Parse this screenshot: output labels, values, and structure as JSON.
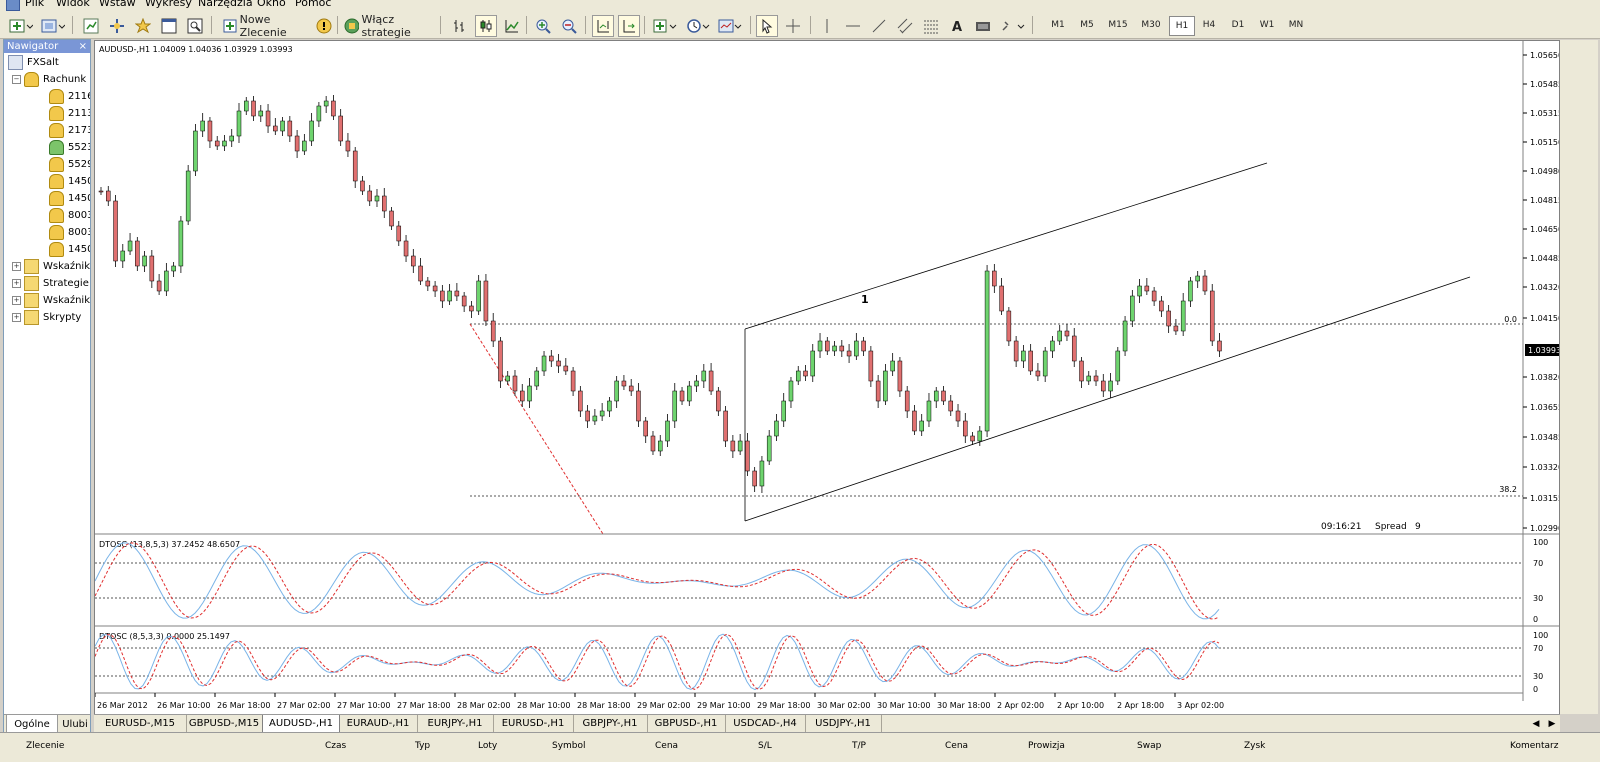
{
  "menu": {
    "items": [
      "Plik",
      "Widok",
      "Wstaw",
      "Wykresy",
      "Narzędzia",
      "Okno",
      "Pomoc"
    ]
  },
  "toolbar": {
    "new_order_label": "Nowe Zlecenie",
    "strategies_label": "Włącz strategie",
    "timeframes": [
      "M1",
      "M5",
      "M15",
      "M30",
      "H1",
      "H4",
      "D1",
      "W1",
      "MN"
    ],
    "active_timeframe": "H1",
    "icons": [
      "new-chart-icon",
      "profiles-icon",
      "market-watch-icon",
      "navigator-icon",
      "favorites-icon",
      "data-window-icon",
      "tester-icon",
      "new-order-icon",
      "alert-icon",
      "expert-icon",
      "bar-chart-icon",
      "candlestick-icon",
      "line-chart-icon",
      "zoom-in-icon",
      "zoom-out-icon",
      "chart-shift-icon",
      "autoscroll-icon",
      "indicators-icon",
      "periods-icon",
      "templates-icon",
      "cursor-icon",
      "crosshair-icon",
      "vertical-line-icon",
      "horizontal-line-icon",
      "trend-line-icon",
      "equidistant-channel-icon",
      "fibonacci-icon",
      "text-icon",
      "text-label-icon",
      "arrows-icon"
    ]
  },
  "navigator": {
    "title": "Nawigator",
    "root": "FXSalt",
    "accounts_label": "Rachunk",
    "accounts": [
      "2116",
      "2113",
      "2173",
      "5523",
      "5529",
      "1450",
      "1450",
      "8003",
      "8003",
      "1450"
    ],
    "sections": [
      "Wskaźnik",
      "Strategie",
      "Wskaźnik",
      "Skrypty"
    ],
    "tabs": [
      "Ogólne",
      "Ulubi"
    ]
  },
  "chart": {
    "header": "AUDUSD-,H1  1.04009 1.04036 1.03929 1.03993",
    "current_price": "1.03993",
    "price_ticks": [
      "1.05650",
      "1.05485",
      "1.05315",
      "1.05150",
      "1.04980",
      "1.04815",
      "1.04650",
      "1.04485",
      "1.04320",
      "1.04150",
      "1.03820",
      "1.03655",
      "1.03485",
      "1.03320",
      "1.03155",
      "1.02990"
    ],
    "time_label": "09:16:21",
    "spread_label": "Spread",
    "spread_value": "9",
    "fib_top_label": "0.0",
    "fib_bottom_label": "38.2",
    "channel_marker": "1",
    "time_ticks": [
      "26 Mar 2012",
      "26 Mar 10:00",
      "26 Mar 18:00",
      "27 Mar 02:00",
      "27 Mar 10:00",
      "27 Mar 18:00",
      "28 Mar 02:00",
      "28 Mar 10:00",
      "28 Mar 18:00",
      "29 Mar 02:00",
      "29 Mar 10:00",
      "29 Mar 18:00",
      "30 Mar 02:00",
      "30 Mar 10:00",
      "30 Mar 18:00",
      "2 Apr 02:00",
      "2 Apr 10:00",
      "2 Apr 18:00",
      "3 Apr 02:00"
    ]
  },
  "oscillator1": {
    "header": "DTOSC (13,8,5,3) 37.2452 48.6507",
    "levels": [
      "100",
      "70",
      "30",
      "0"
    ]
  },
  "oscillator2": {
    "header": "DTOSC (8,5,3,3) 0.0000 25.1497",
    "levels": [
      "100",
      "70",
      "30",
      "0"
    ]
  },
  "chart_tabs": [
    "EURUSD-,M15",
    "GBPUSD-,M15",
    "AUDUSD-,H1",
    "EURAUD-,H1",
    "EURJPY-,H1",
    "EURUSD-,H1",
    "GBPJPY-,H1",
    "GBPUSD-,H1",
    "USDCAD-,H4",
    "USDJPY-,H1"
  ],
  "active_chart_tab": "AUDUSD-,H1",
  "terminal": {
    "columns": [
      "Zlecenie",
      "Czas",
      "Typ",
      "Loty",
      "Symbol",
      "Cena",
      "S/L",
      "T/P",
      "Cena",
      "Prowizja",
      "Swap",
      "Zysk",
      "Komentarz"
    ]
  },
  "colors": {
    "bull": "#6ed46e",
    "bear": "#e07070",
    "channel": "#000000",
    "fib": "#e03030",
    "osc_main": "#7ab4e8",
    "osc_signal": "#e03030"
  }
}
